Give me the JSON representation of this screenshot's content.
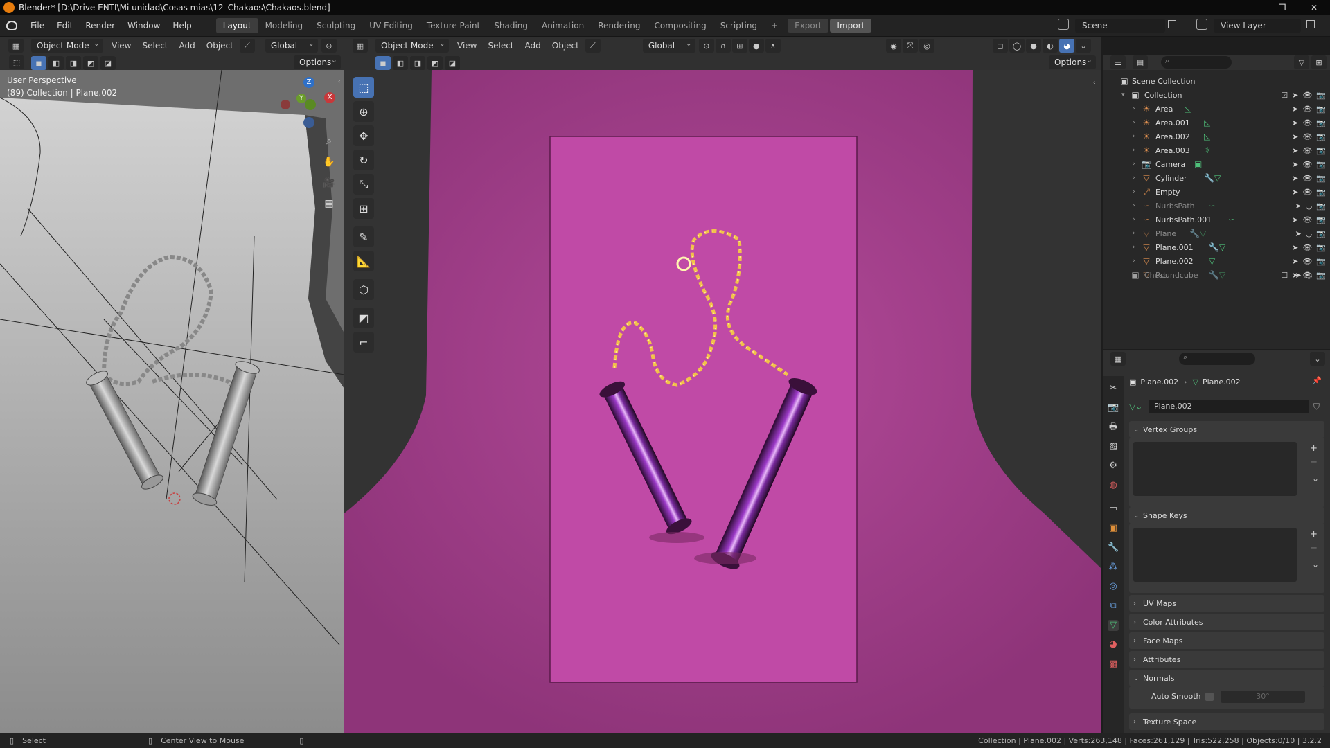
{
  "window": {
    "title": "Blender* [D:\\Drive ENTI\\Mi unidad\\Cosas mias\\12_Chakaos\\Chakaos.blend]",
    "controls": [
      "—",
      "❐",
      "✕"
    ]
  },
  "menu": [
    "File",
    "Edit",
    "Render",
    "Window",
    "Help"
  ],
  "workspaces": [
    "Layout",
    "Modeling",
    "Sculpting",
    "UV Editing",
    "Texture Paint",
    "Shading",
    "Animation",
    "Rendering",
    "Compositing",
    "Scripting",
    "+"
  ],
  "active_workspace": "Layout",
  "topbar_right": {
    "export_label": "Export",
    "import_label": "Import",
    "scene_label": "Scene",
    "view_layer_label": "View Layer"
  },
  "left_viewport": {
    "mode": "Object Mode",
    "menus": [
      "View",
      "Select",
      "Add",
      "Object"
    ],
    "orientation": "Global",
    "options_label": "Options",
    "info_line1": "User Perspective",
    "info_line2": "(89) Collection | Plane.002",
    "gizmo": {
      "z": "Z",
      "y": "Y",
      "x": "X"
    }
  },
  "main_viewport": {
    "mode": "Object Mode",
    "menus": [
      "View",
      "Select",
      "Add",
      "Object"
    ],
    "orientation": "Global",
    "options_label": "Options",
    "background_color": "#a33d8a",
    "camera_frame_color": "#c04aa6"
  },
  "outliner": {
    "root": "Scene Collection",
    "collection": "Collection",
    "items": [
      {
        "name": "Area",
        "icon": "light-icon",
        "data_icon": "area-light-data-icon",
        "dim": false
      },
      {
        "name": "Area.001",
        "icon": "light-icon",
        "data_icon": "area-light-data-icon",
        "dim": false
      },
      {
        "name": "Area.002",
        "icon": "light-icon",
        "data_icon": "area-light-data-icon",
        "dim": false
      },
      {
        "name": "Area.003",
        "icon": "light-icon",
        "data_icon": "sun-light-data-icon",
        "dim": false
      },
      {
        "name": "Camera",
        "icon": "camera-icon",
        "data_icon": "camera-data-icon",
        "dim": false
      },
      {
        "name": "Cylinder",
        "icon": "mesh-icon",
        "data_icon": "modifier-mesh-data-icon",
        "dim": false
      },
      {
        "name": "Empty",
        "icon": "empty-icon",
        "data_icon": "",
        "dim": false
      },
      {
        "name": "NurbsPath",
        "icon": "curve-icon",
        "data_icon": "curve-data-icon",
        "dim": true
      },
      {
        "name": "NurbsPath.001",
        "icon": "curve-icon",
        "data_icon": "curve-data-icon",
        "dim": false
      },
      {
        "name": "Plane",
        "icon": "mesh-icon",
        "data_icon": "modifier-mesh-data-icon",
        "dim": true
      },
      {
        "name": "Plane.001",
        "icon": "mesh-icon",
        "data_icon": "modifier-mesh-data-icon",
        "dim": false
      },
      {
        "name": "Plane.002",
        "icon": "mesh-icon",
        "data_icon": "mesh-data-icon",
        "dim": false
      },
      {
        "name": "Roundcube",
        "icon": "mesh-icon",
        "data_icon": "modifier-mesh-data-icon",
        "dim": true
      }
    ],
    "chest": "Chest"
  },
  "properties": {
    "breadcrumb_object": "Plane.002",
    "breadcrumb_data": "Plane.002",
    "data_name": "Plane.002",
    "panels": {
      "vertex_groups": "Vertex Groups",
      "shape_keys": "Shape Keys",
      "uv_maps": "UV Maps",
      "color_attributes": "Color Attributes",
      "face_maps": "Face Maps",
      "attributes": "Attributes",
      "normals": "Normals",
      "auto_smooth": "Auto Smooth",
      "auto_smooth_angle": "30°",
      "texture_space": "Texture Space"
    }
  },
  "statusbar": {
    "select": "Select",
    "center_view": "Center View to Mouse",
    "stats": "Collection | Plane.002 | Verts:263,148 | Faces:261,129 | Tris:522,258 | Objects:0/10 | 3.2.2"
  }
}
